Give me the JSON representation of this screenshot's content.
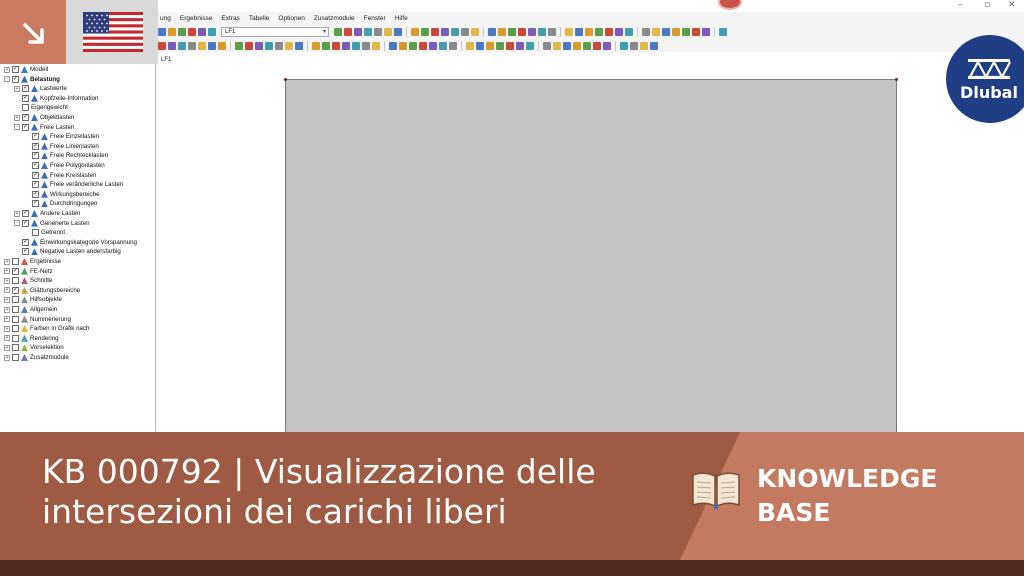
{
  "menu": [
    "ung",
    "Ergebnisse",
    "Extras",
    "Tabelle",
    "Optionen",
    "Zusatzmodule",
    "Fenster",
    "Hilfe"
  ],
  "toolbar": {
    "load_case_value": "LF1"
  },
  "work_area": {
    "load_case_label": "LF1"
  },
  "navigator": {
    "items": [
      {
        "label": "Modell",
        "checked": true,
        "icon": "model-icon"
      },
      {
        "label": "Belastung",
        "checked": true,
        "icon": "load-icon"
      },
      {
        "label": "Lastwerte",
        "checked": true,
        "icon": "load-values-icon"
      },
      {
        "label": "Kopfzeile-Information",
        "checked": true,
        "icon": "load-icon"
      },
      {
        "label": "Eigengewicht",
        "checked": false,
        "icon": ""
      },
      {
        "label": "Objektlasten",
        "checked": true,
        "icon": "load-icon"
      },
      {
        "label": "Freie Lasten",
        "checked": true,
        "icon": "load-icon"
      },
      {
        "label": "Freie Einzellasten",
        "checked": true,
        "icon": "load-icon"
      },
      {
        "label": "Freie Linienlasten",
        "checked": true,
        "icon": "load-icon"
      },
      {
        "label": "Freie Rechtecklasten",
        "checked": true,
        "icon": "load-icon"
      },
      {
        "label": "Freie Polygonlasten",
        "checked": true,
        "icon": "load-icon"
      },
      {
        "label": "Freie Kreislasten",
        "checked": true,
        "icon": "load-icon"
      },
      {
        "label": "Freie veränderliche Lasten",
        "checked": true,
        "icon": "load-icon"
      },
      {
        "label": "Wirkungsbereiche",
        "checked": true,
        "icon": "load-icon"
      },
      {
        "label": "Durchdringungen",
        "checked": true,
        "icon": "load-icon"
      },
      {
        "label": "Andere Lasten",
        "checked": true,
        "icon": "load-icon"
      },
      {
        "label": "Generierte Lasten",
        "checked": true,
        "icon": "load-icon"
      },
      {
        "label": "Getrennt",
        "checked": false,
        "icon": ""
      },
      {
        "label": "Einwirkungskategorie Vorspannung",
        "checked": true,
        "icon": "load-icon"
      },
      {
        "label": "Negative Lasten andersfarbig",
        "checked": true,
        "icon": "load-icon"
      },
      {
        "label": "Ergebnisse",
        "checked": false,
        "icon": "results-icon"
      },
      {
        "label": "FE-Netz",
        "checked": true,
        "icon": "mesh-icon"
      },
      {
        "label": "Schnitte",
        "checked": false,
        "icon": "section-icon"
      },
      {
        "label": "Glättungsbereiche",
        "checked": true,
        "icon": "smoothing-icon"
      },
      {
        "label": "Hilfsobjekte",
        "checked": false,
        "icon": "guide-objects-icon"
      },
      {
        "label": "Allgemein",
        "checked": false,
        "icon": "general-icon"
      },
      {
        "label": "Nummerierung",
        "checked": false,
        "icon": "numbering-icon"
      },
      {
        "label": "Farben in Grafik nach",
        "checked": false,
        "icon": "colors-icon"
      },
      {
        "label": "Rendering",
        "checked": false,
        "icon": "rendering-icon"
      },
      {
        "label": "Vorselektion",
        "checked": false,
        "icon": "preselection-icon"
      },
      {
        "label": "Zusatzmodule",
        "checked": false,
        "icon": "addon-icon"
      }
    ]
  },
  "overlay": {
    "flag": "us-flag",
    "arrow": "arrow-down-right-icon"
  },
  "brand": {
    "logo_text": "Dlubal",
    "logo_color": "#1f3e86"
  },
  "banner": {
    "title_line1": "KB 000792 | Visualizzazione delle",
    "title_line2": "intersezioni dei carichi liberi",
    "label_line1": "KNOWLEDGE",
    "label_line2": "BASE",
    "color_dark": "#9e5a42",
    "color_light": "#c47a60"
  }
}
